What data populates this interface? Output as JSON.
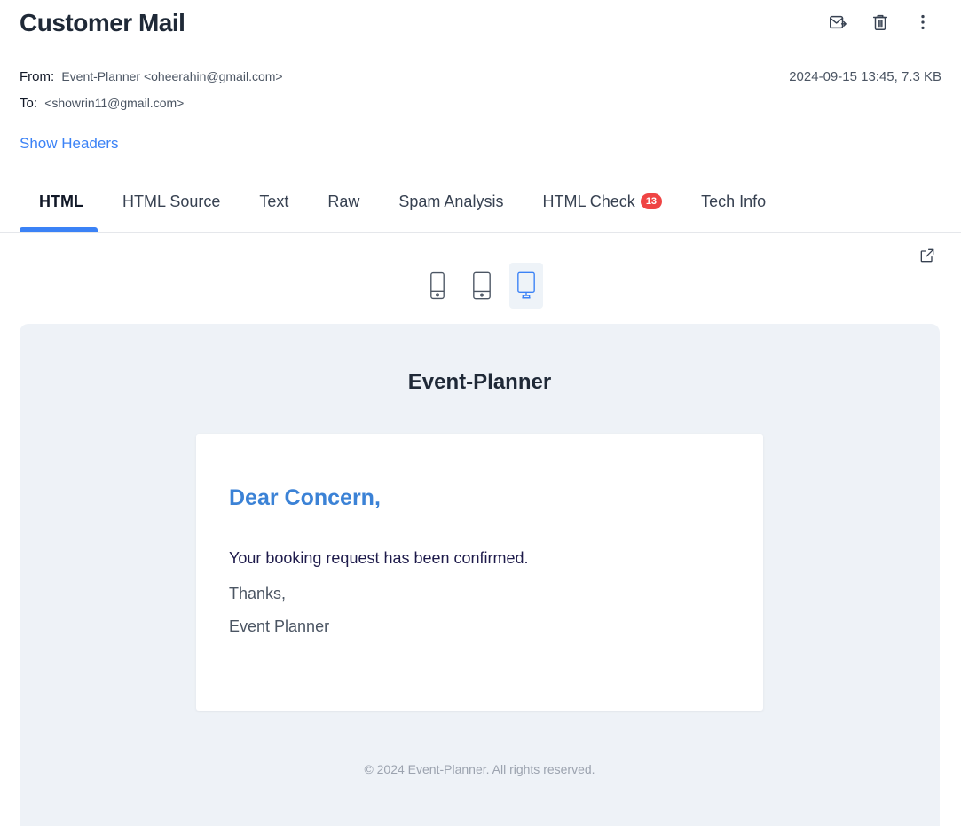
{
  "header": {
    "title": "Customer Mail",
    "from_label": "From:",
    "from_value": "Event-Planner <oheerahin@gmail.com>",
    "to_label": "To:",
    "to_value": "<showrin11@gmail.com>",
    "date_size": "2024-09-15 13:45, 7.3 KB",
    "show_headers": "Show Headers",
    "actions": [
      "forward-icon",
      "trash-icon",
      "more-vertical-icon"
    ]
  },
  "tabs": [
    {
      "label": "HTML",
      "active": true
    },
    {
      "label": "HTML Source"
    },
    {
      "label": "Text"
    },
    {
      "label": "Raw"
    },
    {
      "label": "Spam Analysis"
    },
    {
      "label": "HTML Check",
      "badge": "13"
    },
    {
      "label": "Tech Info"
    }
  ],
  "devices": [
    "mobile-icon",
    "tablet-icon",
    "desktop-icon"
  ],
  "active_device": "desktop",
  "email": {
    "brand": "Event-Planner",
    "greeting": "Dear Concern,",
    "line1": "Your booking request has been confirmed.",
    "line2": "Thanks,",
    "line3": "Event Planner",
    "footer": "© 2024 Event-Planner. All rights reserved."
  },
  "colors": {
    "accent": "#3b82f6",
    "badge": "#ef4444",
    "preview_bg": "#eef2f7"
  }
}
